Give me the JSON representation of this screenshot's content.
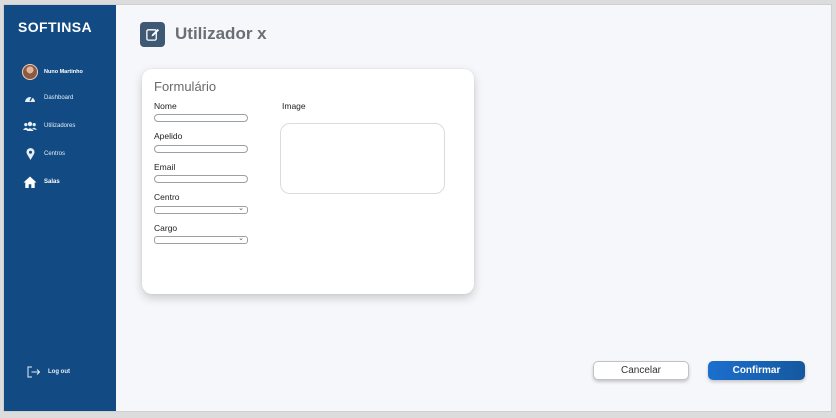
{
  "app": {
    "logo": "SOFTINSA"
  },
  "sidebar": {
    "profile_name": "Nuno Martinho",
    "items": [
      {
        "label": "Dashboard",
        "icon": "dashboard-gauge-icon"
      },
      {
        "label": "Utilizadores",
        "icon": "users-icon"
      },
      {
        "label": "Centros",
        "icon": "location-pin-icon"
      },
      {
        "label": "Salas",
        "icon": "home-icon"
      }
    ],
    "logout_label": "Log out"
  },
  "header": {
    "title": "Utilizador x",
    "icon": "edit-icon"
  },
  "form": {
    "title": "Formulário",
    "fields": [
      {
        "label": "Nome",
        "value": ""
      },
      {
        "label": "Apelido",
        "value": ""
      },
      {
        "label": "Email",
        "value": ""
      },
      {
        "label": "Centro",
        "value": ""
      },
      {
        "label": "Cargo",
        "value": ""
      }
    ],
    "image_label": "Image"
  },
  "actions": {
    "cancel_label": "Cancelar",
    "confirm_label": "Confirmar"
  },
  "colors": {
    "sidebar": "#124b84",
    "primary": "#1c6fce",
    "header_icon_bg": "#3f5873"
  }
}
